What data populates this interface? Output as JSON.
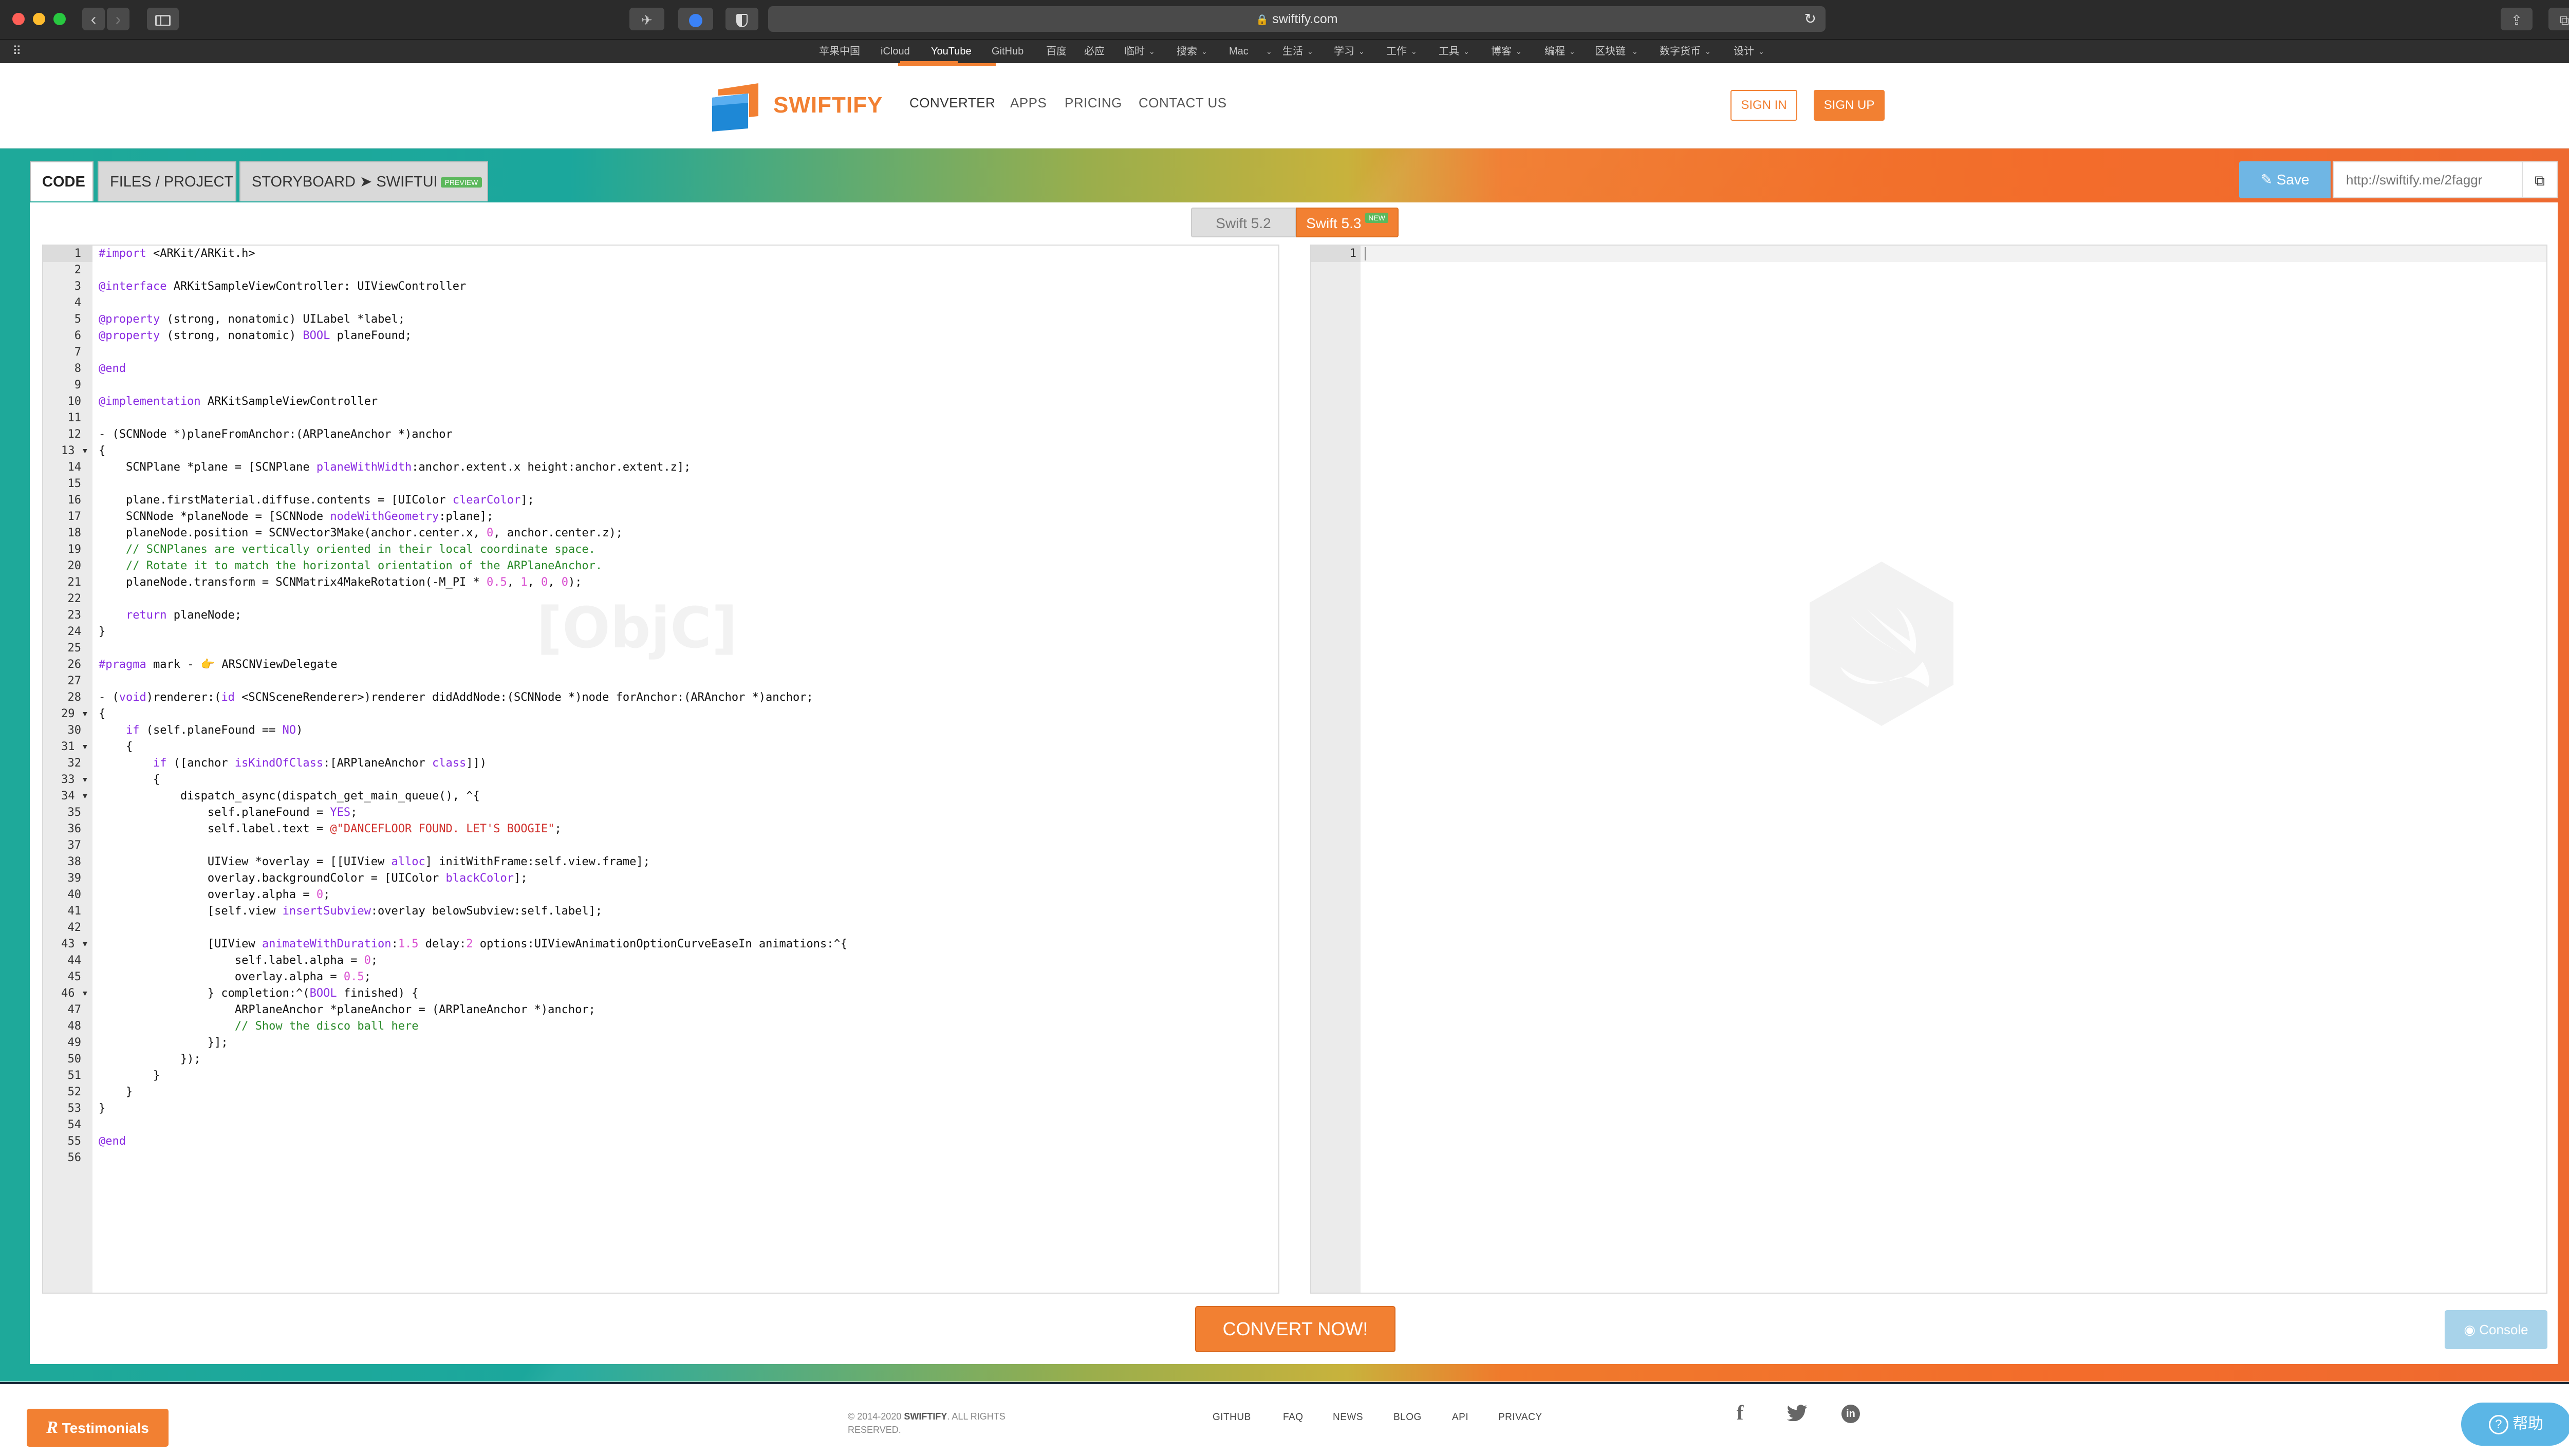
{
  "browser": {
    "url": "swiftify.com",
    "favorites": [
      "苹果中国",
      "iCloud",
      "YouTube",
      "GitHub",
      "百度",
      "必应",
      "临时",
      "搜索",
      "Mac",
      "生活",
      "学习",
      "工作",
      "工具",
      "博客",
      "编程",
      "区块链",
      "数字货币",
      "设计"
    ]
  },
  "site": {
    "brand": "SWIFTIFY",
    "nav": [
      "CONVERTER",
      "APPS",
      "PRICING",
      "CONTACT US"
    ],
    "sign_in": "SIGN IN",
    "sign_up": "SIGN UP"
  },
  "editor": {
    "tabs": [
      "CODE",
      "FILES / PROJECT",
      "STORYBOARD ➤ SWIFTUI"
    ],
    "preview_badge": "PREVIEW",
    "save_label": "Save",
    "share_placeholder": "http://swiftify.me/2faggr",
    "version_a": "Swift 5.2",
    "version_b": "Swift 5.3",
    "new_badge": "NEW",
    "left_watermark": "[ObjC]",
    "right_line_number": "1"
  },
  "code_lines": [
    "#import <ARKit/ARKit.h>",
    "",
    "@interface ARKitSampleViewController: UIViewController",
    "",
    "@property (strong, nonatomic) UILabel *label;",
    "@property (strong, nonatomic) BOOL planeFound;",
    "",
    "@end",
    "",
    "@implementation ARKitSampleViewController",
    "",
    "- (SCNNode *)planeFromAnchor:(ARPlaneAnchor *)anchor",
    "{",
    "    SCNPlane *plane = [SCNPlane planeWithWidth:anchor.extent.x height:anchor.extent.z];",
    "",
    "    plane.firstMaterial.diffuse.contents = [UIColor clearColor];",
    "    SCNNode *planeNode = [SCNNode nodeWithGeometry:plane];",
    "    planeNode.position = SCNVector3Make(anchor.center.x, 0, anchor.center.z);",
    "    // SCNPlanes are vertically oriented in their local coordinate space.",
    "    // Rotate it to match the horizontal orientation of the ARPlaneAnchor.",
    "    planeNode.transform = SCNMatrix4MakeRotation(-M_PI * 0.5, 1, 0, 0);",
    "",
    "    return planeNode;",
    "}",
    "",
    "#pragma mark - 👉 ARSCNViewDelegate",
    "",
    "- (void)renderer:(id <SCNSceneRenderer>)renderer didAddNode:(SCNNode *)node forAnchor:(ARAnchor *)anchor;",
    "{",
    "    if (self.planeFound == NO)",
    "    {",
    "        if ([anchor isKindOfClass:[ARPlaneAnchor class]])",
    "        {",
    "            dispatch_async(dispatch_get_main_queue(), ^{",
    "                self.planeFound = YES;",
    "                self.label.text = @\"DANCEFLOOR FOUND. LET'S BOOGIE\";",
    "",
    "                UIView *overlay = [[UIView alloc] initWithFrame:self.view.frame];",
    "                overlay.backgroundColor = [UIColor blackColor];",
    "                overlay.alpha = 0;",
    "                [self.view insertSubview:overlay belowSubview:self.label];",
    "",
    "                [UIView animateWithDuration:1.5 delay:2 options:UIViewAnimationOptionCurveEaseIn animations:^{",
    "                    self.label.alpha = 0;",
    "                    overlay.alpha = 0.5;",
    "                } completion:^(BOOL finished) {",
    "                    ARPlaneAnchor *planeAnchor = (ARPlaneAnchor *)anchor;",
    "                    // Show the disco ball here",
    "                }];",
    "            });",
    "        }",
    "    }",
    "}",
    "",
    "@end",
    ""
  ],
  "fold_lines": [
    13,
    29,
    31,
    33,
    34,
    43,
    46
  ],
  "actions": {
    "convert": "CONVERT NOW!",
    "console": "Console",
    "testimonials": "Testimonials",
    "help": "帮助"
  },
  "footer": {
    "copyright_prefix": "© 2014-2020 ",
    "copyright_brand": "SWIFTIFY",
    "copyright_suffix": ". ALL RIGHTS RESERVED.",
    "links": [
      "GITHUB",
      "FAQ",
      "NEWS",
      "BLOG",
      "API",
      "PRIVACY"
    ]
  },
  "colors": {
    "accent_orange": "#f28032",
    "teal": "#1ea99a",
    "save_blue": "#6fb6e4"
  }
}
